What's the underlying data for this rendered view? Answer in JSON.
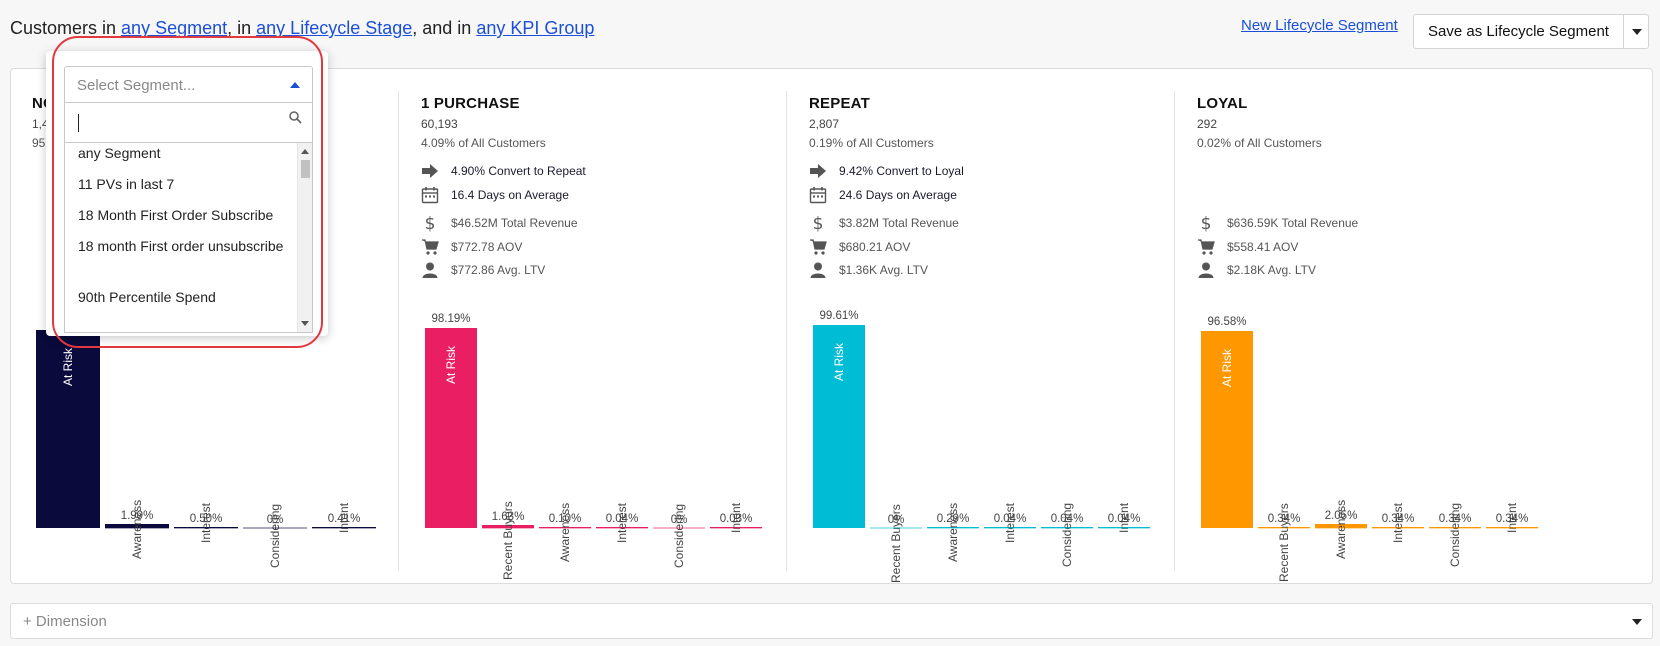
{
  "header": {
    "prefix": "Customers in",
    "segment_link": "any Segment",
    "sep1": ", in",
    "lifecycle_link": "any Lifecycle Stage",
    "sep2": ", and in",
    "kpi_link": "any KPI Group",
    "new_segment_link": "New Lifecycle Segment",
    "save_button": "Save as Lifecycle Segment"
  },
  "dropdown": {
    "placeholder": "Select Segment...",
    "search_value": "",
    "options": [
      "any Segment",
      "11 PVs in last 7",
      "18 Month First Order Subscribe",
      "18 month First order unsubscribe",
      "90th Percentile Spend"
    ]
  },
  "dimension_label": "+ Dimension",
  "colors": {
    "stage_no": "#0a0a3c",
    "stage_1p": "#e91e63",
    "stage_repeat": "#00bcd4",
    "stage_loyal": "#ff9800",
    "link": "#1b4fd8",
    "highlight": "#e0393e"
  },
  "stages": [
    {
      "title": "NO PURCHASE",
      "count": "1,409,...",
      "share": "95.70% of All Customers",
      "metrics": []
    },
    {
      "title": "1 PURCHASE",
      "count": "60,193",
      "share": "4.09% of All Customers",
      "metrics": [
        {
          "icon": "arrow-right-icon",
          "text": "4.90% Convert to Repeat"
        },
        {
          "icon": "calendar-icon",
          "text": "16.4 Days on Average"
        },
        {
          "icon": "dollar-icon",
          "text": "$46.52M Total Revenue"
        },
        {
          "icon": "cart-icon",
          "text": "$772.78 AOV"
        },
        {
          "icon": "user-icon",
          "text": "$772.86 Avg. LTV"
        }
      ]
    },
    {
      "title": "REPEAT",
      "count": "2,807",
      "share": "0.19% of All Customers",
      "metrics": [
        {
          "icon": "arrow-right-icon",
          "text": "9.42% Convert to Loyal"
        },
        {
          "icon": "calendar-icon",
          "text": "24.6 Days on Average"
        },
        {
          "icon": "dollar-icon",
          "text": "$3.82M Total Revenue"
        },
        {
          "icon": "cart-icon",
          "text": "$680.21 AOV"
        },
        {
          "icon": "user-icon",
          "text": "$1.36K Avg. LTV"
        }
      ]
    },
    {
      "title": "LOYAL",
      "count": "292",
      "share": "0.02% of All Customers",
      "metrics": [
        {
          "icon": "dollar-icon",
          "text": "$636.59K Total Revenue"
        },
        {
          "icon": "cart-icon",
          "text": "$558.41 AOV"
        },
        {
          "icon": "user-icon",
          "text": "$2.18K Avg. LTV"
        }
      ]
    }
  ],
  "chart_data": [
    {
      "type": "bar",
      "stage": "NO PURCHASE",
      "categories": [
        "At Risk",
        "Awareness",
        "Interest",
        "Considering",
        "Intent"
      ],
      "labels": [
        "97.11%",
        "1.99%",
        "0.50%",
        "0%",
        "0.41%"
      ],
      "values": [
        97.11,
        1.99,
        0.5,
        0,
        0.41
      ],
      "ylim": [
        0,
        100
      ]
    },
    {
      "type": "bar",
      "stage": "1 PURCHASE",
      "categories": [
        "At Risk",
        "Recent Buyers",
        "Awareness",
        "Interest",
        "Considering",
        "Intent"
      ],
      "labels": [
        "98.19%",
        "1.63%",
        "0.10%",
        "0.04%",
        "0%",
        "0.03%"
      ],
      "values": [
        98.19,
        1.63,
        0.1,
        0.04,
        0,
        0.03
      ],
      "ylim": [
        0,
        100
      ]
    },
    {
      "type": "bar",
      "stage": "REPEAT",
      "categories": [
        "At Risk",
        "Recent Buyers",
        "Awareness",
        "Interest",
        "Considering",
        "Intent"
      ],
      "labels": [
        "99.61%",
        "0%",
        "0.29%",
        "0.04%",
        "0.04%",
        "0.04%"
      ],
      "values": [
        99.61,
        0,
        0.29,
        0.04,
        0.04,
        0.04
      ],
      "ylim": [
        0,
        100
      ]
    },
    {
      "type": "bar",
      "stage": "LOYAL",
      "categories": [
        "At Risk",
        "Recent Buyers",
        "Awareness",
        "Interest",
        "Considering",
        "Intent"
      ],
      "labels": [
        "96.58%",
        "0.34%",
        "2.05%",
        "0.34%",
        "0.34%",
        "0.34%"
      ],
      "values": [
        96.58,
        0.34,
        2.05,
        0.34,
        0.34,
        0.34
      ],
      "ylim": [
        0,
        100
      ]
    }
  ]
}
